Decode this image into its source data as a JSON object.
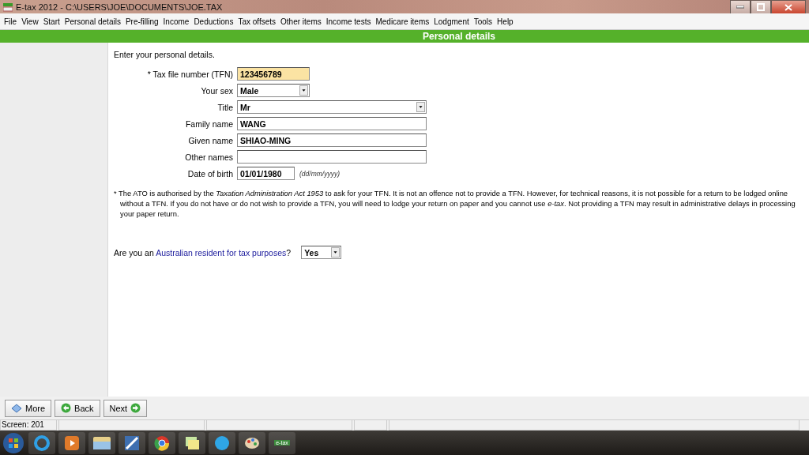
{
  "window": {
    "title": "E-tax 2012 - C:\\USERS\\JOE\\DOCUMENTS\\JOE.TAX"
  },
  "menu": [
    "File",
    "View",
    "Start",
    "Personal details",
    "Pre-filling",
    "Income",
    "Deductions",
    "Tax offsets",
    "Other items",
    "Income tests",
    "Medicare items",
    "Lodgment",
    "Tools",
    "Help"
  ],
  "header": {
    "title": "Personal details"
  },
  "form": {
    "intro": "Enter your personal details.",
    "fields": [
      {
        "kind": "short-text",
        "label": "* Tax file number (TFN)",
        "value": "123456789",
        "highlighted": true
      },
      {
        "kind": "short-select",
        "label": "Your sex",
        "value": "Male",
        "highlighted": false
      },
      {
        "kind": "wide-select",
        "label": "Title",
        "value": "Mr",
        "highlighted": false
      },
      {
        "kind": "wide-text",
        "label": "Family name",
        "value": "WANG",
        "highlighted": false
      },
      {
        "kind": "wide-text",
        "label": "Given name",
        "value": "SHIAO-MING",
        "highlighted": false
      },
      {
        "kind": "wide-text",
        "label": "Other names",
        "highlighted": false
      },
      {
        "kind": "date",
        "label": "Date of birth",
        "value": "01/01/1980",
        "highlighted": false,
        "hint": "(dd/mm/yyyy)"
      }
    ],
    "footnote": "* The ATO is authorised by the *Taxation Administration Act 1953* to ask for your TFN. It is not an offence not to provide a TFN. However, for technical reasons, it is not possible for a return to be lodged online without a TFN. If you do not have or do not wish to provide a TFN, you will need to lodge your return on paper and you cannot use *e-tax*. Not providing a TFN may result in administrative delays in processing your paper return.",
    "question": {
      "before": "Are you an ",
      "link": "Australian resident for tax purposes",
      "after": "?",
      "value": "Yes"
    }
  },
  "buttons": [
    {
      "kind": "more",
      "label": "More"
    },
    {
      "kind": "back",
      "label": "Back"
    },
    {
      "kind": "next",
      "label": "Next"
    }
  ],
  "status_bar": {
    "screen": "Screen: 201"
  },
  "taskbar": {
    "etax_label": "e-tax"
  }
}
